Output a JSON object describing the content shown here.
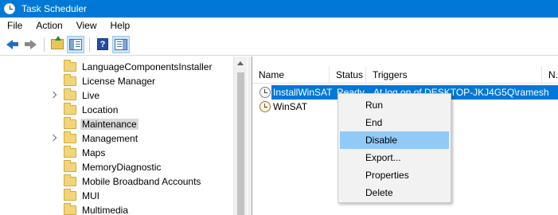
{
  "window": {
    "title": "Task Scheduler"
  },
  "menubar": {
    "items": [
      "File",
      "Action",
      "View",
      "Help"
    ]
  },
  "toolbar": {
    "buttons": [
      "back-icon",
      "forward-icon",
      "up-folder-icon",
      "show-hide-tree-icon",
      "help-icon",
      "show-hide-action-pane-icon"
    ]
  },
  "tree": {
    "items": [
      {
        "label": "LanguageComponentsInstaller",
        "expandable": false,
        "selected": false
      },
      {
        "label": "License Manager",
        "expandable": false,
        "selected": false
      },
      {
        "label": "Live",
        "expandable": true,
        "selected": false
      },
      {
        "label": "Location",
        "expandable": false,
        "selected": false
      },
      {
        "label": "Maintenance",
        "expandable": false,
        "selected": true
      },
      {
        "label": "Management",
        "expandable": true,
        "selected": false
      },
      {
        "label": "Maps",
        "expandable": false,
        "selected": false
      },
      {
        "label": "MemoryDiagnostic",
        "expandable": false,
        "selected": false
      },
      {
        "label": "Mobile Broadband Accounts",
        "expandable": false,
        "selected": false
      },
      {
        "label": "MUI",
        "expandable": false,
        "selected": false
      },
      {
        "label": "Multimedia",
        "expandable": false,
        "selected": false
      }
    ]
  },
  "list": {
    "columns": [
      "Name",
      "Status",
      "Triggers",
      "N."
    ],
    "rows": [
      {
        "name": "InstallWinSAT",
        "status": "Ready",
        "triggers": "At log on of DESKTOP-JKJ4G5Q\\ramesh",
        "selected": true
      },
      {
        "name": "WinSAT",
        "status": "",
        "triggers": "",
        "selected": false
      }
    ]
  },
  "context_menu": {
    "items": [
      "Run",
      "End",
      "Disable",
      "Export...",
      "Properties",
      "Delete"
    ],
    "highlighted": "Disable"
  },
  "colors": {
    "titlebar": "#0078d7",
    "selection": "#0078d7",
    "menu_hover": "#91c9f7"
  }
}
